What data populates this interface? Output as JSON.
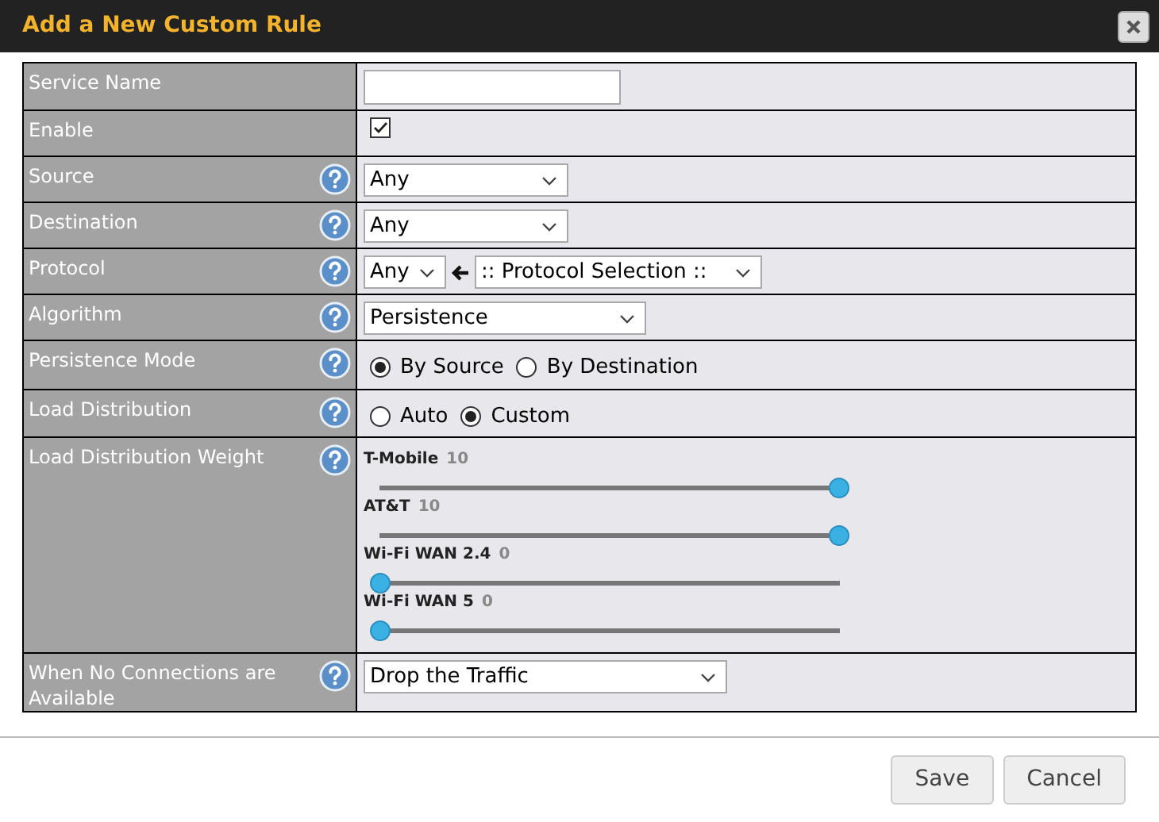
{
  "dialog": {
    "title": "Add a New Custom Rule"
  },
  "rows": [
    {
      "label": "Service Name",
      "help": false,
      "kind": "text",
      "value": ""
    },
    {
      "label": "Enable",
      "help": false,
      "kind": "checkbox",
      "checked": true
    },
    {
      "label": "Source",
      "help": true,
      "kind": "select",
      "value": "Any"
    },
    {
      "label": "Destination",
      "help": true,
      "kind": "select",
      "value": "Any"
    },
    {
      "label": "Protocol",
      "help": true,
      "kind": "protocol",
      "value": "Any",
      "selection": ":: Protocol Selection ::"
    },
    {
      "label": "Algorithm",
      "help": true,
      "kind": "select",
      "value": "Persistence"
    },
    {
      "label": "Persistence Mode",
      "help": true,
      "kind": "radio",
      "options": [
        {
          "label": "By Source",
          "selected": true
        },
        {
          "label": "By Destination",
          "selected": false
        }
      ]
    },
    {
      "label": "Load Distribution",
      "help": true,
      "kind": "radio",
      "options": [
        {
          "label": "Auto",
          "selected": false
        },
        {
          "label": "Custom",
          "selected": true
        }
      ]
    },
    {
      "label": "Load Distribution Weight",
      "help": true,
      "kind": "sliders",
      "sliders": [
        {
          "name": "T-Mobile",
          "reading": "10",
          "level": 1
        },
        {
          "name": "AT&T",
          "reading": "10",
          "level": 1
        },
        {
          "name": "Wi-Fi WAN 2.4",
          "reading": "0",
          "level": 0
        },
        {
          "name": "Wi-Fi WAN 5",
          "reading": "0",
          "level": 0
        }
      ]
    },
    {
      "label": "When No Connections are Available",
      "help": true,
      "kind": "select",
      "value": "Drop the Traffic"
    }
  ],
  "buttons": [
    "Save",
    "Cancel"
  ]
}
